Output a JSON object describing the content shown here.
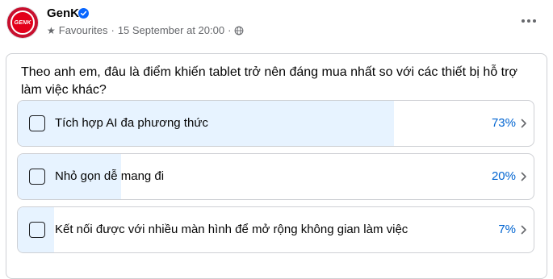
{
  "header": {
    "avatar_text": "GENK",
    "page_name": "GenK",
    "audience": "Favourites",
    "separator": "·",
    "timestamp": "15 September at 20:00",
    "separator2": "·",
    "verified_icon": "verified-badge-icon",
    "audience_icon": "star-icon",
    "privacy_icon": "globe-icon",
    "more_icon": "more-options-icon"
  },
  "poll": {
    "question": "Theo anh em, đâu là điểm khiến tablet trở nên đáng mua nhất so với các thiết bị hỗ trợ làm việc khác?",
    "options": [
      {
        "label": "Tích hợp AI đa phương thức",
        "percent_label": "73%",
        "percent": 73
      },
      {
        "label": "Nhỏ gọn dễ mang đi",
        "percent_label": "20%",
        "percent": 20
      },
      {
        "label": "Kết nối được với nhiều màn hình để mở rộng không gian làm việc",
        "percent_label": "7%",
        "percent": 7
      }
    ],
    "colors": {
      "fill": "#e7f3ff",
      "percent": "#0064d1",
      "border": "#ced0d4"
    }
  }
}
